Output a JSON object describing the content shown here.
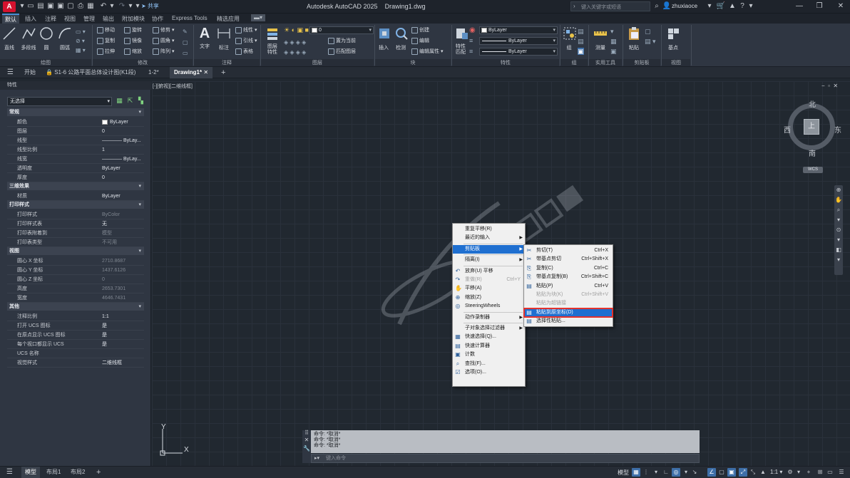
{
  "titlebar": {
    "logo": "A",
    "share_label": "共享",
    "title": "Autodesk AutoCAD 2025    Drawing1.dwg",
    "search_placeholder": "键入关键字或短语",
    "username": "zhuxiaoce"
  },
  "ribbon_tabs": [
    "默认",
    "插入",
    "注释",
    "视图",
    "管理",
    "输出",
    "附加模块",
    "协作",
    "Express Tools",
    "精选应用"
  ],
  "ribbon": {
    "draw": {
      "label": "绘图",
      "line": "直线",
      "polyline": "多段线",
      "circle": "圆",
      "arc": "圆弧"
    },
    "modify": {
      "label": "修改",
      "items": [
        "移动",
        "旋转",
        "修剪",
        "复制",
        "镜像",
        "圆角",
        "拉伸",
        "缩放",
        "阵列"
      ]
    },
    "annotation": {
      "label": "注释",
      "text": "文字",
      "dimension": "标注",
      "items": [
        "线性",
        "引线",
        "表格"
      ]
    },
    "layers": {
      "label": "图层",
      "layer_props": "图层\n特性",
      "layer_value": "0",
      "items": [
        "置为当前",
        "匹配图层"
      ]
    },
    "block": {
      "label": "块",
      "insert": "插入",
      "items": [
        "创建",
        "编辑",
        "编辑属性"
      ],
      "inspect": "检测"
    },
    "properties": {
      "label": "特性",
      "match": "特性\n匹配",
      "color": "ByLayer",
      "linetype": "ByLayer",
      "lineweight": "ByLayer"
    },
    "groups": {
      "label": "组",
      "group": "组"
    },
    "utilities": {
      "label": "实用工具",
      "measure": "测量"
    },
    "clipboard": {
      "label": "剪贴板",
      "paste": "粘贴"
    },
    "view": {
      "label": "视图",
      "base": "基点"
    }
  },
  "doc_tabs": [
    "开始",
    "S1-6 公路平面总体设计图(K1段)",
    "1-2*",
    "Drawing1*"
  ],
  "properties_panel": {
    "title": "特性",
    "selection": "无选择",
    "sections": [
      {
        "name": "常规",
        "rows": [
          {
            "k": "颜色",
            "v": "ByLayer",
            "swatch": true
          },
          {
            "k": "图层",
            "v": "0"
          },
          {
            "k": "线型",
            "v": "———— ByLay..."
          },
          {
            "k": "线型比例",
            "v": "1"
          },
          {
            "k": "线宽",
            "v": "———— ByLay..."
          },
          {
            "k": "透明度",
            "v": "ByLayer"
          },
          {
            "k": "厚度",
            "v": "0"
          }
        ]
      },
      {
        "name": "三维效果",
        "rows": [
          {
            "k": "材质",
            "v": "ByLayer"
          }
        ]
      },
      {
        "name": "打印样式",
        "rows": [
          {
            "k": "打印样式",
            "v": "ByColor",
            "dim": true
          },
          {
            "k": "打印样式表",
            "v": "无"
          },
          {
            "k": "打印表附着到",
            "v": "模型",
            "dim": true
          },
          {
            "k": "打印表类型",
            "v": "不可用",
            "dim": true
          }
        ]
      },
      {
        "name": "视图",
        "rows": [
          {
            "k": "圆心 X 坐标",
            "v": "2710.8687",
            "dim": true
          },
          {
            "k": "圆心 Y 坐标",
            "v": "1437.6126",
            "dim": true
          },
          {
            "k": "圆心 Z 坐标",
            "v": "0",
            "dim": true
          },
          {
            "k": "高度",
            "v": "2653.7301",
            "dim": true
          },
          {
            "k": "宽度",
            "v": "4646.7431",
            "dim": true
          }
        ]
      },
      {
        "name": "其他",
        "rows": [
          {
            "k": "注释比例",
            "v": "1:1"
          },
          {
            "k": "打开 UCS 图标",
            "v": "是"
          },
          {
            "k": "在原点显示 UCS 图标",
            "v": "是"
          },
          {
            "k": "每个视口都显示 UCS",
            "v": "是"
          },
          {
            "k": "UCS 名称",
            "v": ""
          },
          {
            "k": "视觉样式",
            "v": "二维线框"
          }
        ]
      }
    ]
  },
  "viewport": {
    "label": "[-][俯视][二维线框]",
    "viewcube": {
      "north": "北",
      "south": "南",
      "east": "东",
      "west": "西",
      "face": "上",
      "ucs": "WCS"
    }
  },
  "context_menu": {
    "items": [
      {
        "t": "重复平移(R)"
      },
      {
        "t": "最近的输入",
        "sub": true
      },
      {
        "sep": true
      },
      {
        "t": "剪贴板",
        "sub": true,
        "highlight": true
      },
      {
        "sep": true
      },
      {
        "t": "隔离(I)",
        "sub": true
      },
      {
        "sep": true
      },
      {
        "t": "放弃(U) 平移",
        "icon": "undo"
      },
      {
        "t": "重做(R)",
        "sc": "Ctrl+Y",
        "disabled": true,
        "icon": "redo"
      },
      {
        "t": "平移(A)",
        "icon": "hand"
      },
      {
        "t": "缩放(Z)",
        "icon": "zoom"
      },
      {
        "t": "SteeringWheels",
        "icon": "wheel"
      },
      {
        "sep": true
      },
      {
        "t": "动作录制器",
        "sub": true
      },
      {
        "sep": true
      },
      {
        "t": "子对象选择过滤器",
        "sub": true
      },
      {
        "t": "快速选择(Q)...",
        "icon": "qselect"
      },
      {
        "t": "快速计算器",
        "icon": "calc"
      },
      {
        "t": "计数",
        "icon": "count"
      },
      {
        "t": "查找(F)...",
        "icon": "find"
      },
      {
        "t": "选项(O)...",
        "icon": "options"
      }
    ]
  },
  "clipboard_submenu": {
    "items": [
      {
        "t": "剪切(T)",
        "sc": "Ctrl+X",
        "icon": "cut"
      },
      {
        "t": "带基点剪切",
        "sc": "Ctrl+Shift+X",
        "icon": "cutbase"
      },
      {
        "t": "复制(C)",
        "sc": "Ctrl+C",
        "icon": "copy"
      },
      {
        "t": "带基点复制(B)",
        "sc": "Ctrl+Shift+C",
        "icon": "copybase"
      },
      {
        "t": "粘贴(P)",
        "sc": "Ctrl+V",
        "icon": "paste"
      },
      {
        "t": "粘贴为块(K)",
        "sc": "Ctrl+Shift+V",
        "disabled": true
      },
      {
        "t": "粘贴为超链接",
        "disabled": true
      },
      {
        "t": "粘贴到原坐标(D)",
        "selected": true,
        "icon": "pasteorig"
      },
      {
        "t": "选择性粘贴...",
        "icon": "pastespecial"
      }
    ]
  },
  "command_line": {
    "history": [
      "命令: *取消*",
      "命令: *取消*",
      "命令: *取消*"
    ],
    "placeholder": "键入命令"
  },
  "ucs_icon": {
    "x": "X",
    "y": "Y"
  },
  "status_bar": {
    "layout_tabs": [
      "模型",
      "布局1",
      "布局2"
    ],
    "model_label": "模型",
    "scale": "1:1"
  }
}
